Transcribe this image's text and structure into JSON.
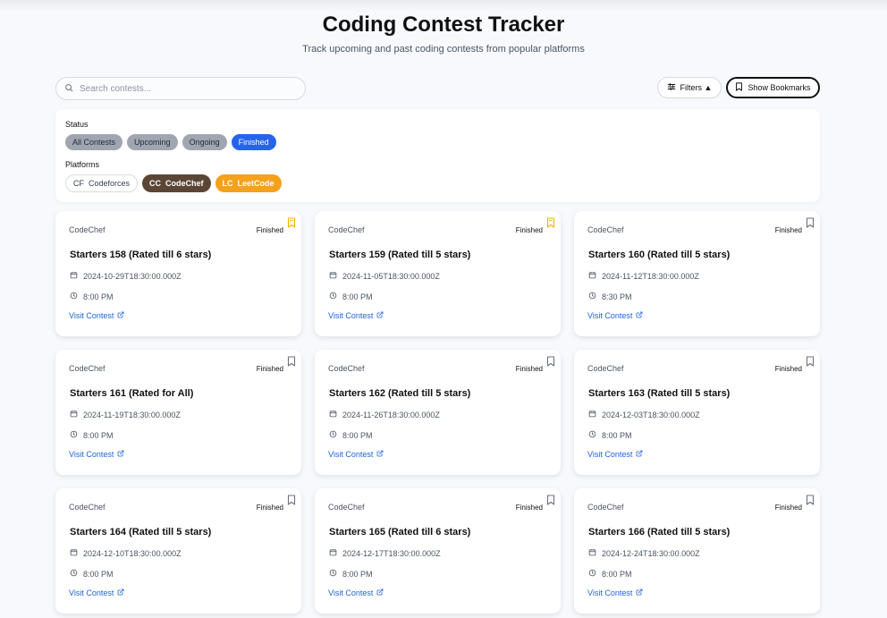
{
  "header": {
    "title": "Coding Contest Tracker",
    "subtitle": "Track upcoming and past coding contests from popular platforms"
  },
  "search": {
    "placeholder": "Search contests...",
    "value": ""
  },
  "toolbar": {
    "filters_label": "Filters ▲",
    "bookmarks_label": "Show Bookmarks"
  },
  "filters": {
    "status_label": "Status",
    "status_options": [
      {
        "label": "All Contests",
        "active": false
      },
      {
        "label": "Upcoming",
        "active": false
      },
      {
        "label": "Ongoing",
        "active": false
      },
      {
        "label": "Finished",
        "active": true
      }
    ],
    "platforms_label": "Platforms",
    "platforms": [
      {
        "abbr": "CF",
        "label": "Codeforces",
        "selected": false
      },
      {
        "abbr": "CC",
        "label": "CodeChef",
        "selected": true,
        "color": "#5b4636"
      },
      {
        "abbr": "LC",
        "label": "LeetCode",
        "selected": true,
        "color": "#f5a11b"
      }
    ]
  },
  "contests": [
    {
      "platform": "CodeChef",
      "status": "Finished",
      "bookmarked": true,
      "name": "Starters 158 (Rated till 6 stars)",
      "date": "2024-10-29T18:30:00.000Z",
      "time": "8:00 PM",
      "link_label": "Visit Contest"
    },
    {
      "platform": "CodeChef",
      "status": "Finished",
      "bookmarked": true,
      "name": "Starters 159 (Rated till 5 stars)",
      "date": "2024-11-05T18:30:00.000Z",
      "time": "8:00 PM",
      "link_label": "Visit Contest"
    },
    {
      "platform": "CodeChef",
      "status": "Finished",
      "bookmarked": false,
      "name": "Starters 160 (Rated till 5 stars)",
      "date": "2024-11-12T18:30:00.000Z",
      "time": "8:30 PM",
      "link_label": "Visit Contest"
    },
    {
      "platform": "CodeChef",
      "status": "Finished",
      "bookmarked": false,
      "name": "Starters 161 (Rated for All)",
      "date": "2024-11-19T18:30:00.000Z",
      "time": "8:00 PM",
      "link_label": "Visit Contest"
    },
    {
      "platform": "CodeChef",
      "status": "Finished",
      "bookmarked": false,
      "name": "Starters 162 (Rated till 5 stars)",
      "date": "2024-11-26T18:30:00.000Z",
      "time": "8:00 PM",
      "link_label": "Visit Contest"
    },
    {
      "platform": "CodeChef",
      "status": "Finished",
      "bookmarked": false,
      "name": "Starters 163 (Rated till 5 stars)",
      "date": "2024-12-03T18:30:00.000Z",
      "time": "8:00 PM",
      "link_label": "Visit Contest"
    },
    {
      "platform": "CodeChef",
      "status": "Finished",
      "bookmarked": false,
      "name": "Starters 164 (Rated till 5 stars)",
      "date": "2024-12-10T18:30:00.000Z",
      "time": "8:00 PM",
      "link_label": "Visit Contest"
    },
    {
      "platform": "CodeChef",
      "status": "Finished",
      "bookmarked": false,
      "name": "Starters 165 (Rated till 6 stars)",
      "date": "2024-12-17T18:30:00.000Z",
      "time": "8:00 PM",
      "link_label": "Visit Contest"
    },
    {
      "platform": "CodeChef",
      "status": "Finished",
      "bookmarked": false,
      "name": "Starters 166 (Rated till 5 stars)",
      "date": "2024-12-24T18:30:00.000Z",
      "time": "8:00 PM",
      "link_label": "Visit Contest"
    }
  ],
  "colors": {
    "accent": "#2563eb",
    "link": "#1d64d8",
    "bookmark_active": "#f5b400",
    "bookmark_inactive": "#6b7280"
  },
  "icons": {
    "search": "search-icon",
    "filters": "sliders-icon",
    "bookmark": "bookmark-icon",
    "date": "calendar-icon",
    "time": "clock-icon",
    "external_link": "external-link-icon"
  }
}
